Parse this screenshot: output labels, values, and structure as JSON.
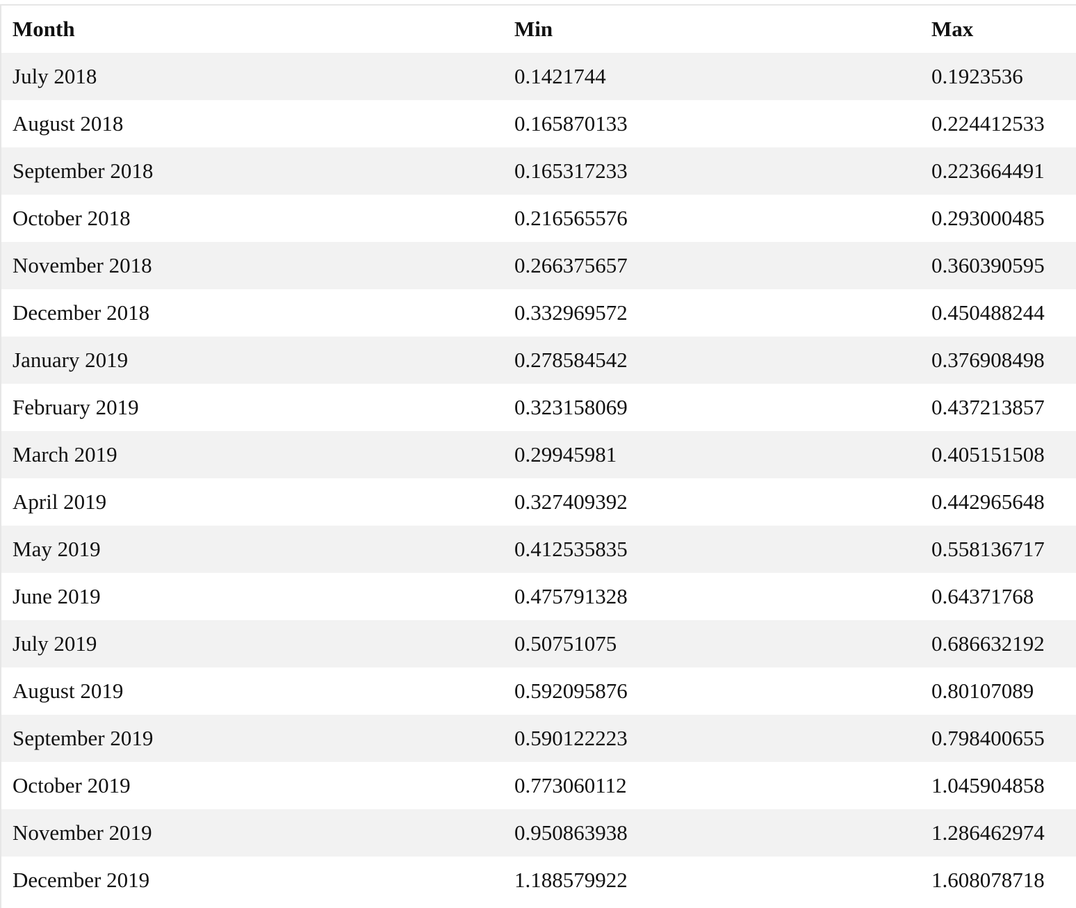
{
  "table": {
    "headers": {
      "month": "Month",
      "min": "Min",
      "max": "Max"
    },
    "rows": [
      {
        "month": "July 2018",
        "min": "0.1421744",
        "max": "0.1923536"
      },
      {
        "month": "August 2018",
        "min": "0.165870133",
        "max": "0.224412533"
      },
      {
        "month": "September 2018",
        "min": "0.165317233",
        "max": "0.223664491"
      },
      {
        "month": "October 2018",
        "min": "0.216565576",
        "max": "0.293000485"
      },
      {
        "month": "November 2018",
        "min": "0.266375657",
        "max": "0.360390595"
      },
      {
        "month": "December 2018",
        "min": "0.332969572",
        "max": "0.450488244"
      },
      {
        "month": "January 2019",
        "min": "0.278584542",
        "max": "0.376908498"
      },
      {
        "month": "February 2019",
        "min": "0.323158069",
        "max": "0.437213857"
      },
      {
        "month": "March 2019",
        "min": "0.29945981",
        "max": "0.405151508"
      },
      {
        "month": "April 2019",
        "min": "0.327409392",
        "max": "0.442965648"
      },
      {
        "month": "May 2019",
        "min": "0.412535835",
        "max": "0.558136717"
      },
      {
        "month": "June 2019",
        "min": "0.475791328",
        "max": "0.64371768"
      },
      {
        "month": "July 2019",
        "min": "0.50751075",
        "max": "0.686632192"
      },
      {
        "month": "August 2019",
        "min": "0.592095876",
        "max": "0.80107089"
      },
      {
        "month": "September 2019",
        "min": "0.590122223",
        "max": "0.798400655"
      },
      {
        "month": "October 2019",
        "min": "0.773060112",
        "max": "1.045904858"
      },
      {
        "month": "November 2019",
        "min": "0.950863938",
        "max": "1.286462974"
      },
      {
        "month": "December 2019",
        "min": "1.188579922",
        "max": "1.608078718"
      }
    ]
  }
}
